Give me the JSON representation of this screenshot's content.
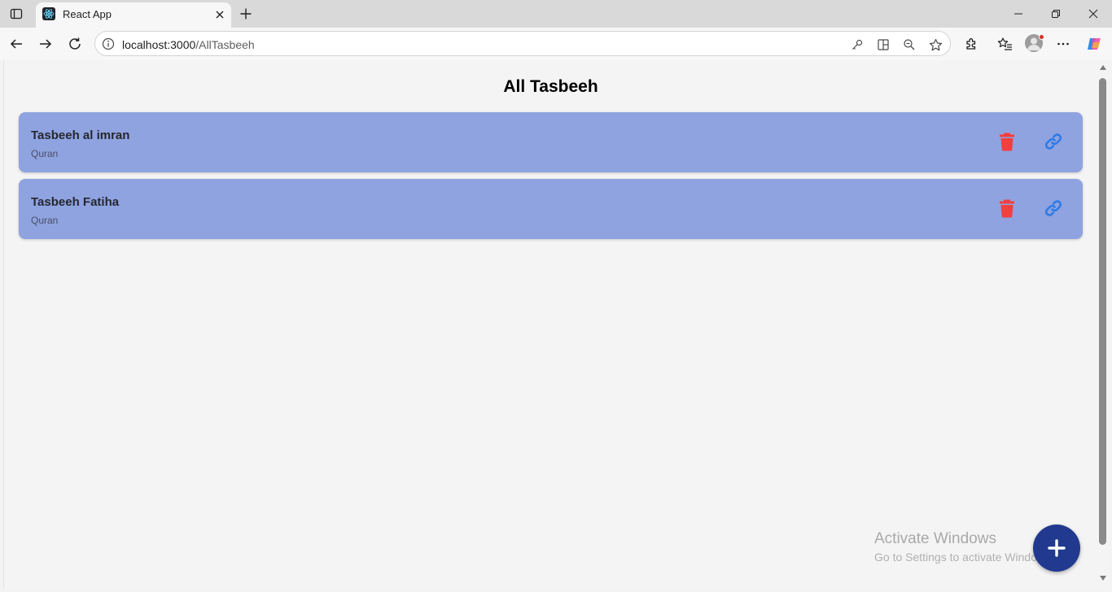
{
  "browser": {
    "tab_title": "React App",
    "url_host": "localhost:3000",
    "url_path": "/AllTasbeeh"
  },
  "page": {
    "title": "All Tasbeeh",
    "items": [
      {
        "name": "Tasbeeh al imran",
        "category": "Quran"
      },
      {
        "name": "Tasbeeh Fatiha",
        "category": "Quran"
      }
    ]
  },
  "watermark": {
    "line1": "Activate Windows",
    "line2": "Go to Settings to activate Windows."
  },
  "colors": {
    "card": "#8fa3e0",
    "delete": "#f23f3f",
    "link": "#2f7be6",
    "fab": "#213a8f"
  },
  "icons": {
    "delete": "trash-icon",
    "link": "link-icon",
    "fab": "plus-icon"
  }
}
